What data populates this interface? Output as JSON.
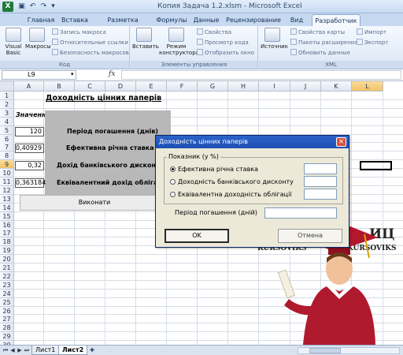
{
  "window": {
    "title": "Копия Задача 1.2.xlsm - Microsoft Excel",
    "app_icon": "excel-icon"
  },
  "quick_access": [
    "save-icon",
    "undo-icon",
    "redo-icon"
  ],
  "ribbon_tabs": [
    {
      "label": "Главная",
      "active": false
    },
    {
      "label": "Вставка",
      "active": false
    },
    {
      "label": "Разметка страницы",
      "active": false
    },
    {
      "label": "Формулы",
      "active": false
    },
    {
      "label": "Данные",
      "active": false
    },
    {
      "label": "Рецензирование",
      "active": false
    },
    {
      "label": "Вид",
      "active": false
    },
    {
      "label": "Разработчик",
      "active": true
    }
  ],
  "ribbon": {
    "code_group": {
      "label": "Код",
      "visual_basic": "Visual Basic",
      "macros": "Макросы",
      "record_macro": "Запись макроса",
      "relative_refs": "Относительные ссылки",
      "macro_security": "Безопасность макросов"
    },
    "controls_group": {
      "label": "Элементы управления",
      "insert": "Вставить",
      "design_mode": "Режим конструктора",
      "properties": "Свойства",
      "view_code": "Просмотр кода",
      "run_dialog": "Отобразить окно"
    },
    "xml_group": {
      "label": "XML",
      "source": "Источник",
      "map_properties": "Свойства карты",
      "expansion_packs": "Пакеты расширения",
      "refresh_data": "Обновить данные",
      "import": "Импорт",
      "export": "Экспорт"
    }
  },
  "formula_bar": {
    "name_box": "L9",
    "fx": "fx",
    "formula": ""
  },
  "columns": [
    "A",
    "B",
    "C",
    "D",
    "E",
    "F",
    "G",
    "H",
    "I",
    "J",
    "K",
    "L"
  ],
  "selected_column": "L",
  "rows": [
    "1",
    "2",
    "3",
    "4",
    "5",
    "6",
    "7",
    "8",
    "9",
    "10",
    "11",
    "12",
    "13",
    "14",
    "15",
    "16",
    "17",
    "18",
    "19",
    "20",
    "21",
    "22",
    "23",
    "24",
    "25",
    "26",
    "27",
    "28",
    "29",
    "30"
  ],
  "selected_row": "9",
  "sheet": {
    "heading": "Доходність цінних паперів",
    "values_label": "Значення",
    "rows": [
      {
        "value": "120",
        "label": "Період погашення (днів)"
      },
      {
        "value": "0,40929",
        "label": "Ефективна річна ставка"
      },
      {
        "value": "0,32",
        "label": "Дохід банківського дисконту"
      },
      {
        "value": "0,363184",
        "label": "Еквівалентний дохід облігації"
      }
    ],
    "run_button": "Виконати"
  },
  "dialog": {
    "title": "Доходність цінних паперів",
    "frame_label": "Показник (у %)",
    "options": [
      {
        "label": "Ефективна річна ставка",
        "selected": true
      },
      {
        "label": "Доходність банківського дисконту",
        "selected": false
      },
      {
        "label": "Еквівалентна доходність облігації",
        "selected": false
      }
    ],
    "period_label": "Період погашення (дній)",
    "ok": "OK",
    "cancel": "Отмена"
  },
  "watermark": {
    "left_logo": "ИЦ",
    "left_caption": "KURSOVIKS",
    "right_logo": "ИЦ",
    "right_caption": "KURSOVIKS"
  },
  "sheet_tabs": [
    {
      "label": "Лист1",
      "active": false
    },
    {
      "label": "Лист2",
      "active": true
    }
  ]
}
